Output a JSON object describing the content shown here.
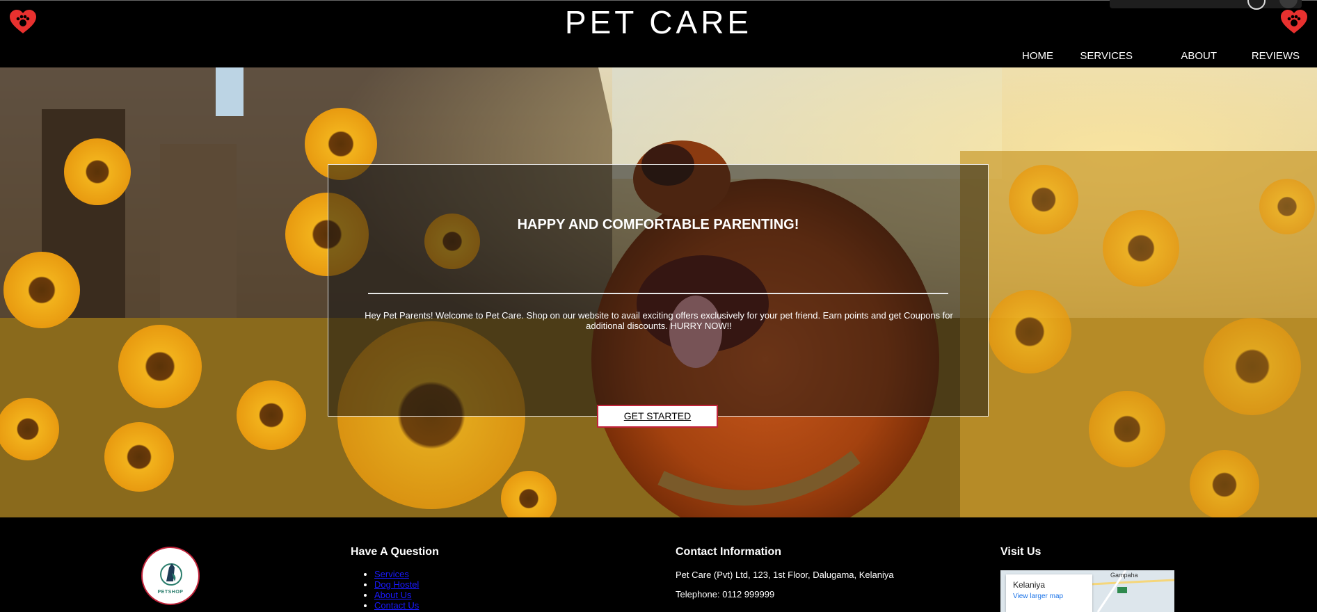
{
  "header": {
    "title": "PET CARE",
    "icons": [
      "heart-paw-icon",
      "heart-paw-icon"
    ],
    "nav": [
      "HOME",
      "SERVICES",
      "ABOUT",
      "REVIEWS"
    ]
  },
  "hero": {
    "heading": "HAPPY AND COMFORTABLE PARENTING!",
    "text": "Hey Pet Parents! Welcome to Pet Care. Shop on our website to avail exciting offers exclusively for your pet friend. Earn points and get Coupons for additional discounts. HURRY NOW!!",
    "button": "GET STARTED",
    "background": "photo of a golden dog in a sunflower field"
  },
  "footer": {
    "logo_text": "PETSHOP",
    "question": {
      "heading": "Have A Question",
      "links": [
        "Services",
        "Dog Hostel",
        "About Us",
        "Contact Us"
      ]
    },
    "contact": {
      "heading": "Contact Information",
      "address": "Pet Care (Pvt) Ltd, 123, 1st Floor, Dalugama, Kelaniya",
      "telephone": "Telephone: 0112 999999"
    },
    "visit": {
      "heading": "Visit Us",
      "map_place": "Kelaniya",
      "map_link": "View larger map",
      "map_town": "Gampaha"
    }
  },
  "colors": {
    "heart": "#e8312f",
    "accent_border": "#c0233a",
    "link": "#1a1aff"
  }
}
